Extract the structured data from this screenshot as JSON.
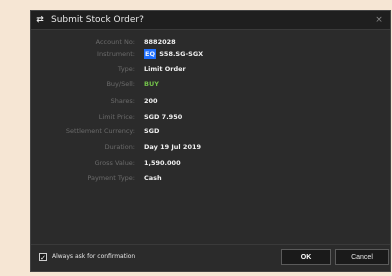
{
  "window": {
    "title": "Submit Stock Order?",
    "app_icon": "currency-exchange-icon",
    "close_symbol": "×"
  },
  "order_details": {
    "account_no": {
      "label": "Account No:",
      "value": "8882028"
    },
    "instrument": {
      "label": "Instrument:",
      "tag": "EQ",
      "value": "S58.SG-SGX"
    },
    "type": {
      "label": "Type:",
      "value": "Limit Order"
    },
    "buy_sell": {
      "label": "Buy/Sell:",
      "value": "BUY"
    },
    "shares": {
      "label": "Shares:",
      "value": "200"
    },
    "limit_price": {
      "label": "Limit Price:",
      "value": "SGD 7.950"
    },
    "settlement_currency": {
      "label": "Settlement Currency:",
      "value": "SGD"
    },
    "duration": {
      "label": "Duration:",
      "value": "Day 19 Jul 2019"
    },
    "gross_value": {
      "label": "Gross Value:",
      "value": "1,590.000"
    },
    "payment_type": {
      "label": "Payment Type:",
      "value": "Cash"
    }
  },
  "footer": {
    "confirm_label": "Always ask for confirmation",
    "confirm_checked": true,
    "ok_label": "OK",
    "cancel_label": "Cancel"
  },
  "colors": {
    "background": "#f6e6d4",
    "dialog": "#2b2b2b",
    "buy": "#73c24a",
    "instrument_tag": "#1f6fff"
  }
}
